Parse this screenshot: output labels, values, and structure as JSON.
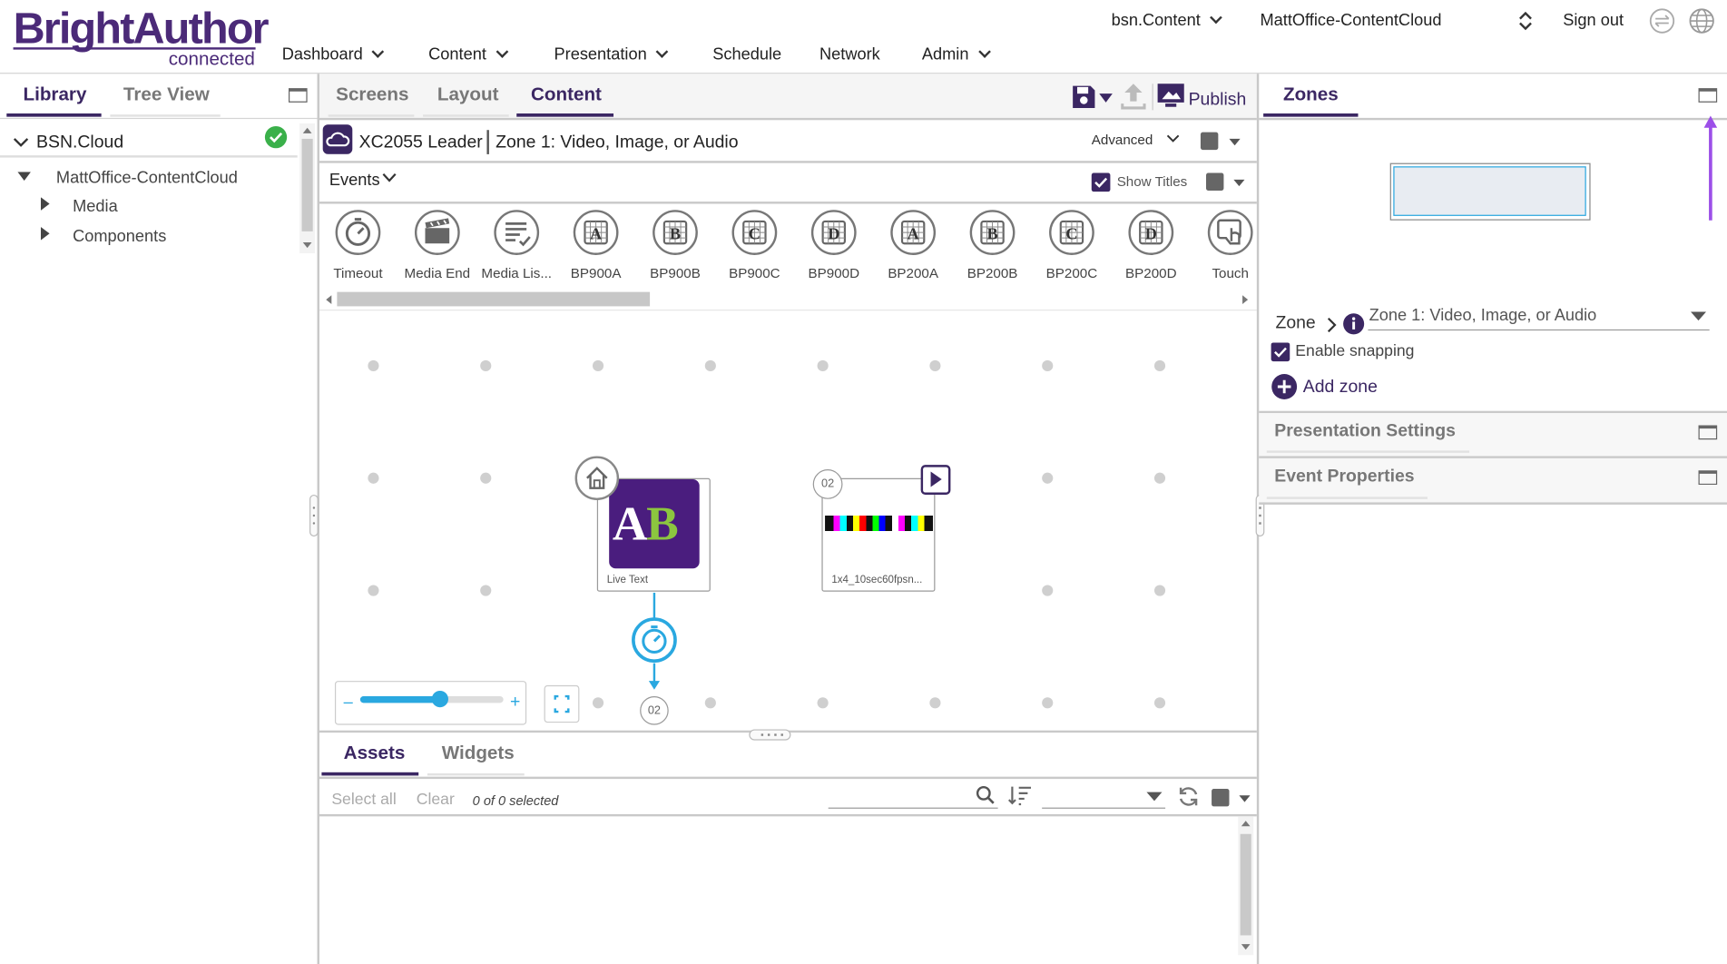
{
  "header": {
    "logo_main": "BrightAuthor",
    "logo_sub": "connected",
    "nav": [
      "Dashboard",
      "Content",
      "Presentation",
      "Schedule",
      "Network",
      "Admin"
    ],
    "account": "bsn.Content",
    "network": "MattOffice-ContentCloud",
    "sign_out": "Sign out"
  },
  "library": {
    "tabs": [
      "Library",
      "Tree View"
    ],
    "root": "BSN.Cloud",
    "network_node": "MattOffice-ContentCloud",
    "children": [
      "Media",
      "Components"
    ]
  },
  "center": {
    "tabs": [
      "Screens",
      "Layout",
      "Content"
    ],
    "publish": "Publish",
    "presentation_title": "XC2055 Leader",
    "zone_title": "Zone 1: Video, Image, or Audio",
    "advanced": "Advanced",
    "events_label": "Events",
    "show_titles": "Show Titles",
    "events": [
      "Timeout",
      "Media End",
      "Media Lis...",
      "BP900A",
      "BP900B",
      "BP900C",
      "BP900D",
      "BP200A",
      "BP200B",
      "BP200C",
      "BP200D",
      "Touch"
    ],
    "node1_label": "Live Text",
    "node1_logo": "AB",
    "node2_number": "02",
    "node2_label": "1x4_10sec60fpsn...",
    "target_number": "02",
    "zoom_minus": "–",
    "zoom_plus": "+",
    "zoom_level": 0.55
  },
  "assets": {
    "tabs": [
      "Assets",
      "Widgets"
    ],
    "select_all": "Select all",
    "clear": "Clear",
    "selected_count": "0 of 0 selected"
  },
  "zones": {
    "tab": "Zones",
    "zone_label": "Zone",
    "zone_value": "Zone 1: Video, Image, or Audio",
    "enable_snapping": "Enable snapping",
    "add_zone": "Add zone",
    "presentation_settings": "Presentation Settings",
    "event_properties": "Event Properties"
  },
  "colors": {
    "brand": "#3b2763",
    "accent": "#2aa8e0",
    "ok": "#3ab04a",
    "arrow": "#9c4fe8"
  }
}
